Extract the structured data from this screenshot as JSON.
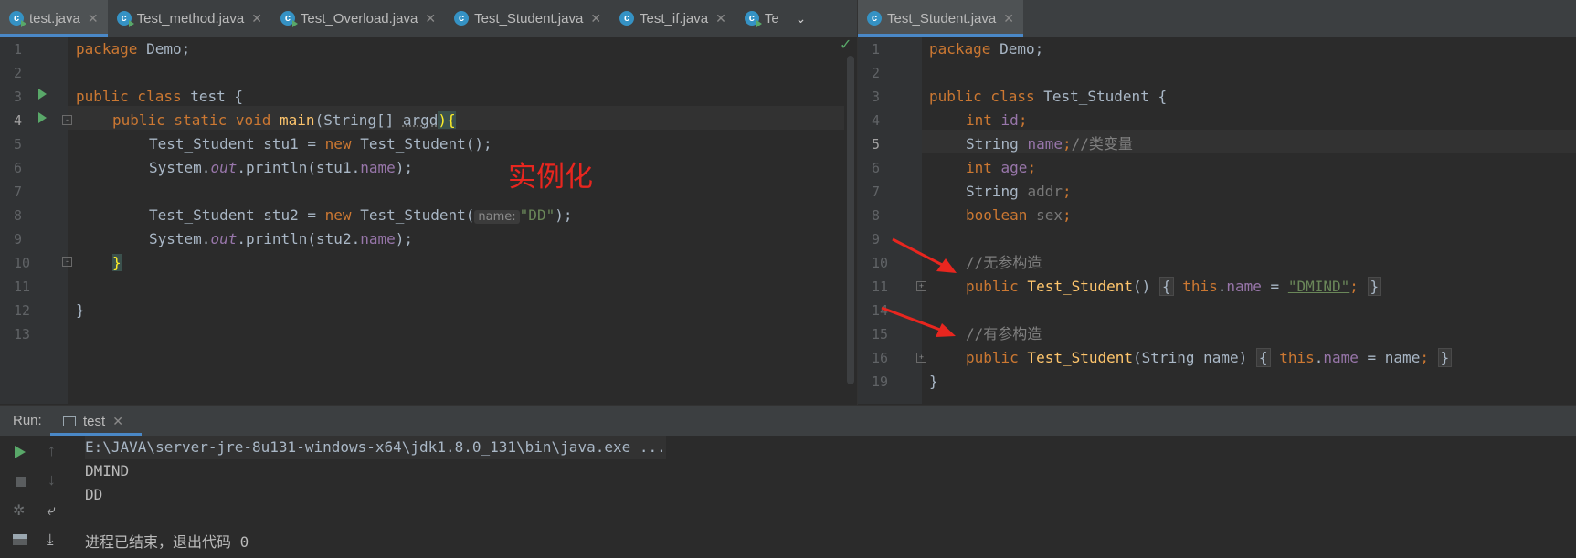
{
  "left_tabs": [
    {
      "label": "test.java",
      "active": true
    },
    {
      "label": "Test_method.java",
      "active": false
    },
    {
      "label": "Test_Overload.java",
      "active": false
    },
    {
      "label": "Test_Student.java",
      "active": false
    },
    {
      "label": "Test_if.java",
      "active": false
    },
    {
      "label": "Te",
      "active": false
    }
  ],
  "right_tabs": [
    {
      "label": "Test_Student.java",
      "active": true
    }
  ],
  "left_editor": {
    "line_numbers": [
      "1",
      "2",
      "3",
      "4",
      "5",
      "6",
      "7",
      "8",
      "9",
      "10",
      "11",
      "12",
      "13"
    ],
    "code": {
      "l1_kw": "package",
      "l1_rest": " Demo;",
      "l3_kw": "public class",
      "l3_rest": " test {",
      "l4_kw": "public static void",
      "l4_fn": "main",
      "l4_p1": "(String[] ",
      "l4_arg": "argd",
      "l4_p2": "){",
      "l5_a": "Test_Student stu1 = ",
      "l5_kw": "new",
      "l5_b": " Test_Student();",
      "l6_a": "System.",
      "l6_out": "out",
      "l6_b": ".println(stu1.",
      "l6_fld": "name",
      "l6_c": ");",
      "l8_a": "Test_Student stu2 = ",
      "l8_kw": "new",
      "l8_b": " Test_Student(",
      "l8_hint": "name:",
      "l8_str": "\"DD\"",
      "l8_c": ");",
      "l9_a": "System.",
      "l9_out": "out",
      "l9_b": ".println(stu2.",
      "l9_fld": "name",
      "l9_c": ");",
      "l10": "}",
      "l12": "}"
    },
    "annotation": "实例化"
  },
  "right_editor": {
    "line_numbers": [
      "1",
      "2",
      "3",
      "4",
      "5",
      "6",
      "7",
      "8",
      "9",
      "10",
      "11",
      "14",
      "15",
      "16",
      "19"
    ],
    "code": {
      "l1_kw": "package",
      "l1_rest": " Demo;",
      "l3_kw": "public class",
      "l3_rest": " Test_Student {",
      "l4_kw": "int",
      "l4_fld": " id",
      "l4_end": ";",
      "l5_a": "String ",
      "l5_fld": "name",
      "l5_end": ";",
      "l5_cmt": "//类变量",
      "l6_kw": "int",
      "l6_fld": " age",
      "l6_end": ";",
      "l7_a": "String ",
      "l7_fld": "addr",
      "l7_end": ";",
      "l8_kw": "boolean",
      "l8_fld": " sex",
      "l8_end": ";",
      "l10_cmt": "//无参构造",
      "l11_kw": "public",
      "l11_fn": " Test_Student",
      "l11_p": "()",
      "l11_ob": "{",
      "l11_this": "this",
      "l11_dot": ".",
      "l11_fld": "name",
      "l11_eq": " = ",
      "l11_str": "\"DMIND\"",
      "l11_semi": ";",
      "l11_cb": "}",
      "l15_cmt": "//有参构造",
      "l16_kw": "public",
      "l16_fn": " Test_Student",
      "l16_p": "(String name)",
      "l16_ob": "{",
      "l16_this": "this",
      "l16_dot": ".",
      "l16_fld": "name",
      "l16_eq": " = name",
      "l16_semi": ";",
      "l16_cb": "}",
      "l19": "}"
    }
  },
  "run_panel": {
    "label": "Run:",
    "tab": "test",
    "output": [
      "E:\\JAVA\\server-jre-8u131-windows-x64\\jdk1.8.0_131\\bin\\java.exe ...",
      "DMIND",
      "DD",
      "",
      "进程已结束，退出代码 0"
    ]
  },
  "colors": {
    "accent": "#4a88c7",
    "keyword": "#cc7832",
    "string": "#6a8759",
    "field": "#9876aa",
    "method": "#ffc66d",
    "annotation_red": "#e8261f"
  }
}
